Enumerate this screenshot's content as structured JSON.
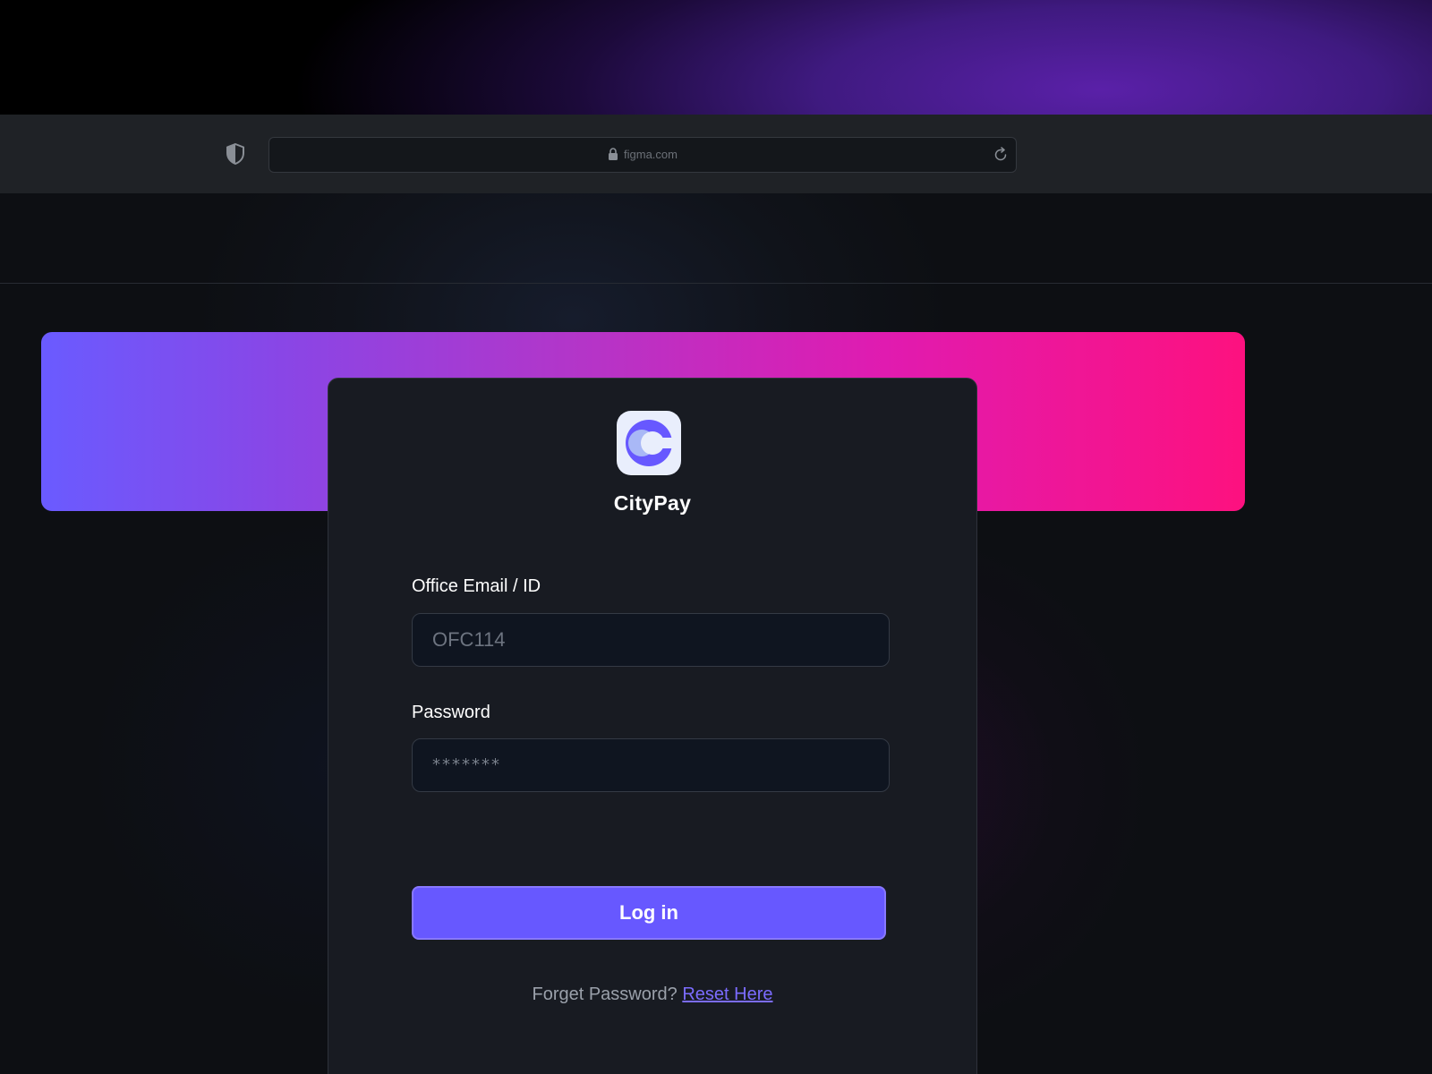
{
  "browser": {
    "url": "figma.com",
    "icons": [
      "shield-icon",
      "lock-icon",
      "reload-icon"
    ]
  },
  "app": {
    "name": "CityPay",
    "logo_icon": "citypay-logo-icon"
  },
  "form": {
    "email_label": "Office Email / ID",
    "email_value": "OFC114",
    "password_label": "Password",
    "password_value": "*******",
    "login_label": "Log in",
    "forgot_text": "Forget Password?",
    "reset_link": "Reset Here"
  },
  "colors": {
    "accent": "#6758FF",
    "banner_start": "#6A5BFF",
    "banner_end": "#FD117F",
    "card_bg": "#181B22",
    "page_bg": "#0E1015"
  }
}
